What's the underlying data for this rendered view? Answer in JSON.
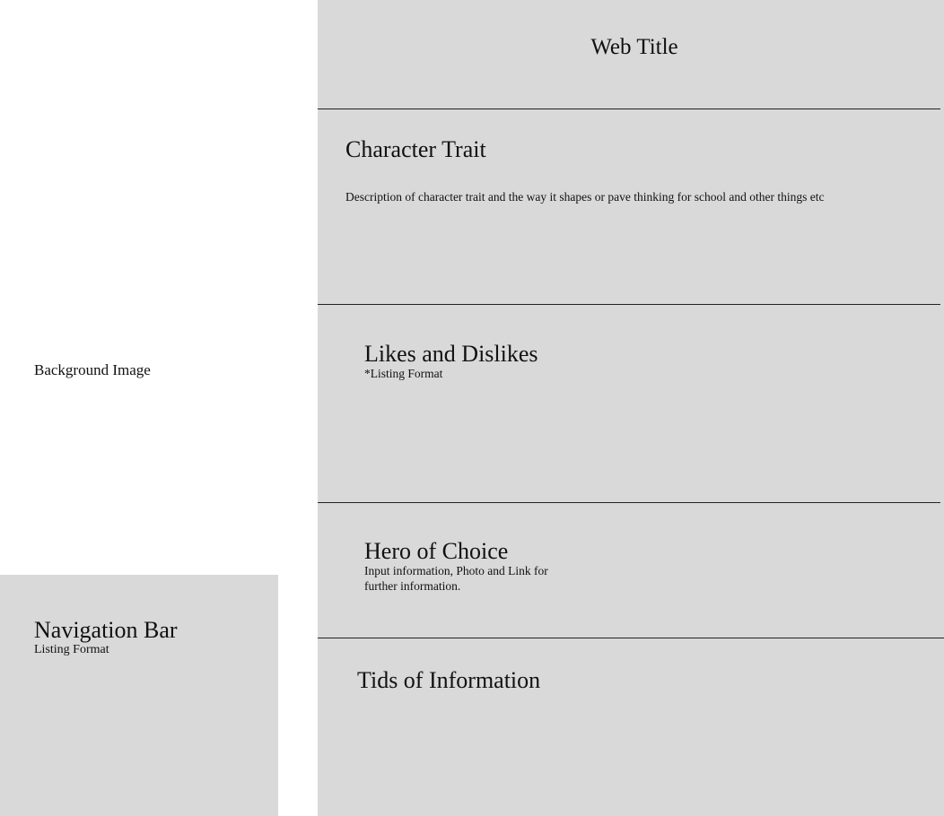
{
  "background": {
    "label": "Background Image"
  },
  "navigation": {
    "title": "Navigation Bar",
    "subtitle": "Listing Format"
  },
  "header": {
    "title": "Web Title"
  },
  "sections": {
    "character_trait": {
      "title": "Character Trait",
      "description": "Description of character trait and the way it shapes or pave thinking for school and other things etc"
    },
    "likes_dislikes": {
      "title": "Likes and Dislikes",
      "note": "*Listing Format"
    },
    "hero": {
      "title": "Hero of Choice",
      "description": "Input information, Photo and Link for further information."
    },
    "tids": {
      "title": "Tids of Information"
    }
  },
  "colors": {
    "panel": "#d9d9d9",
    "background": "#ffffff",
    "divider": "#222222"
  }
}
